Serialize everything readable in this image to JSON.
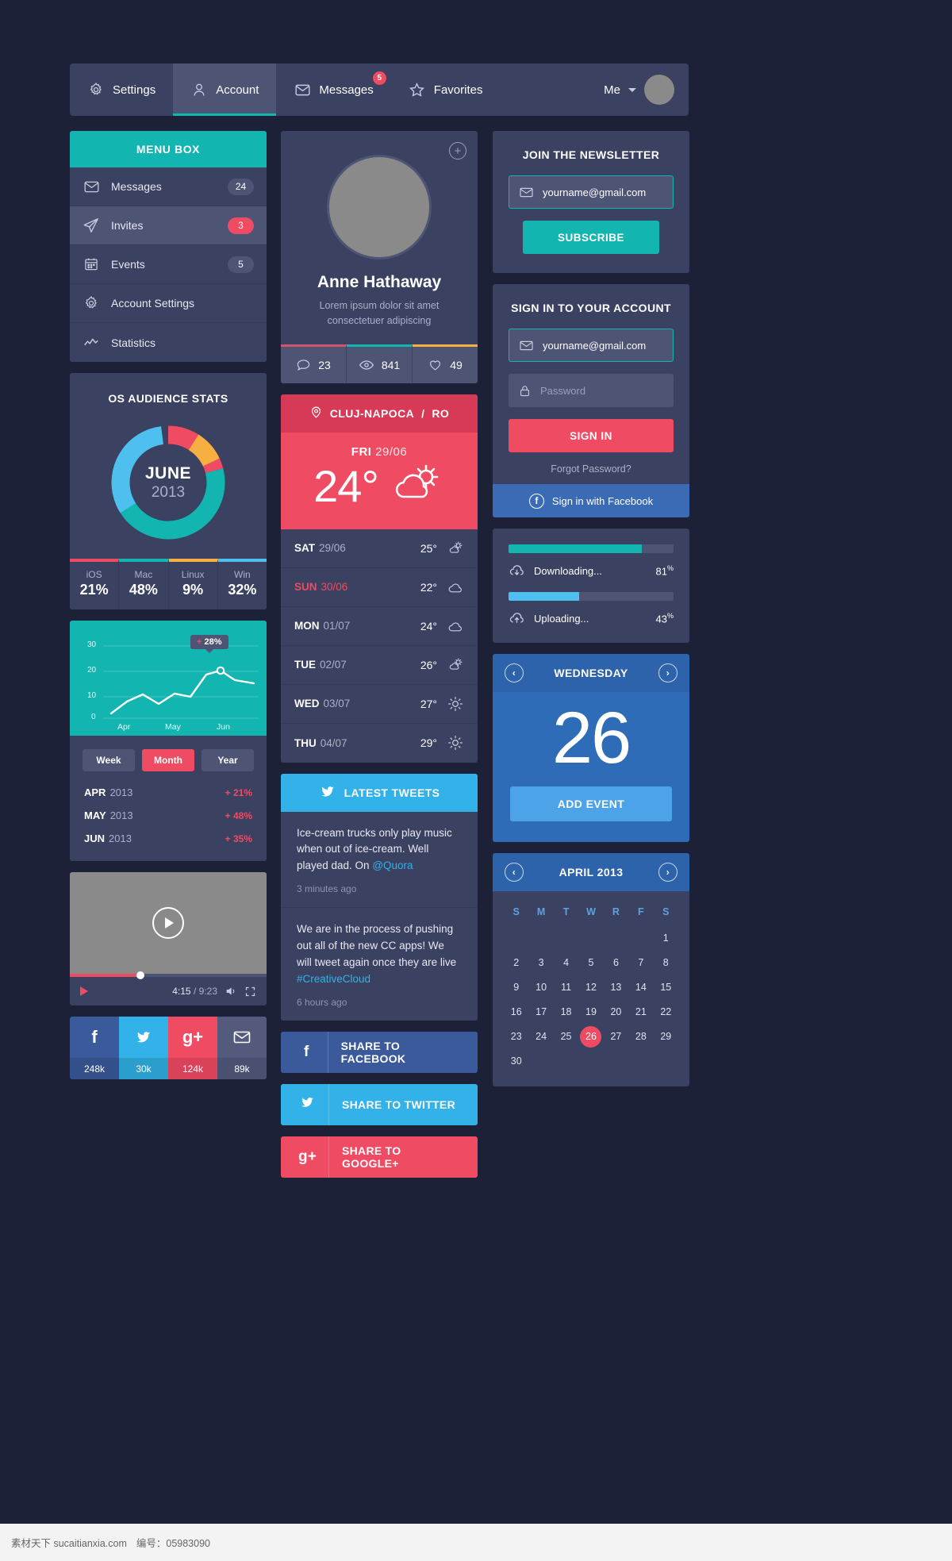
{
  "nav": {
    "items": [
      {
        "label": "Settings",
        "icon": "gear-icon",
        "badge": null,
        "active": false
      },
      {
        "label": "Account",
        "icon": "user-icon",
        "badge": null,
        "active": true
      },
      {
        "label": "Messages",
        "icon": "envelope-icon",
        "badge": "5",
        "active": false
      },
      {
        "label": "Favorites",
        "icon": "star-icon",
        "badge": null,
        "active": false
      }
    ],
    "me_label": "Me"
  },
  "menu_box": {
    "title": "MENU BOX",
    "items": [
      {
        "label": "Messages",
        "icon": "envelope-icon",
        "badge": "24",
        "badge_style": "grey",
        "highlight": false
      },
      {
        "label": "Invites",
        "icon": "paper-plane-icon",
        "badge": "3",
        "badge_style": "pink",
        "highlight": true
      },
      {
        "label": "Events",
        "icon": "calendar-icon",
        "badge": "5",
        "badge_style": "grey",
        "highlight": false
      },
      {
        "label": "Account Settings",
        "icon": "gear-icon",
        "badge": null,
        "badge_style": null,
        "highlight": false
      },
      {
        "label": "Statistics",
        "icon": "chart-line-icon",
        "badge": null,
        "badge_style": null,
        "highlight": false
      }
    ]
  },
  "os_stats": {
    "title": "OS AUDIENCE STATS",
    "center_month": "JUNE",
    "center_year": "2013"
  },
  "chart_data": [
    {
      "type": "pie",
      "title": "OS AUDIENCE STATS",
      "labels": [
        "iOS",
        "Mac",
        "Linux",
        "Win"
      ],
      "values": [
        21,
        48,
        9,
        32
      ],
      "display_values": [
        "21%",
        "48%",
        "9%",
        "32%"
      ],
      "colors": [
        "#ef4b63",
        "#12b5b0",
        "#f5b041",
        "#4dc0f0"
      ],
      "center_label": "JUNE 2013",
      "legend": "bottom"
    },
    {
      "type": "line",
      "title": "",
      "x": [
        "",
        "",
        "",
        "",
        "",
        "",
        "",
        "",
        "",
        ""
      ],
      "values": [
        3,
        7,
        11,
        13,
        8,
        13,
        15,
        13,
        22,
        19,
        16
      ],
      "ylabel": "",
      "xlabel": "",
      "tick_labels_y": [
        "0",
        "10",
        "20",
        "30"
      ],
      "tick_labels_x": [
        "Apr",
        "May",
        "Jun"
      ],
      "ylim": [
        0,
        33
      ],
      "annotation": "+ 28%",
      "grid": true,
      "background": "#12b5b0",
      "line_color": "#ffffff"
    }
  ],
  "trend": {
    "tabs": [
      {
        "label": "Week",
        "active": false
      },
      {
        "label": "Month",
        "active": true
      },
      {
        "label": "Year",
        "active": false
      }
    ],
    "tooltip_sign": "+",
    "tooltip_value": "28%",
    "y_ticks": [
      "30",
      "20",
      "10",
      "0"
    ],
    "x_ticks": [
      "Apr",
      "May",
      "Jun"
    ],
    "rows": [
      {
        "month": "APR",
        "year": "2013",
        "delta": "+ 21%"
      },
      {
        "month": "MAY",
        "year": "2013",
        "delta": "+ 48%"
      },
      {
        "month": "JUN",
        "year": "2013",
        "delta": "+ 35%"
      }
    ]
  },
  "video": {
    "current_time": "4:15",
    "total_time": "9:23",
    "separator": "/"
  },
  "social": [
    {
      "network": "facebook",
      "glyph": "f",
      "count": "248k"
    },
    {
      "network": "twitter",
      "glyph": "t",
      "count": "30k"
    },
    {
      "network": "googleplus",
      "glyph": "g+",
      "count": "124k"
    },
    {
      "network": "mail",
      "glyph": "m",
      "count": "89k"
    }
  ],
  "profile": {
    "name": "Anne Hathaway",
    "description": "Lorem ipsum dolor sit amet consectetuer adipiscing",
    "stats": [
      {
        "icon": "comment-icon",
        "value": "23",
        "color": "#d0566f"
      },
      {
        "icon": "eye-icon",
        "value": "841",
        "color": "#12b5b0"
      },
      {
        "icon": "heart-icon",
        "value": "49",
        "color": "#f5b041"
      }
    ]
  },
  "weather": {
    "city": "CLUJ-NAPOCA",
    "country": "RO",
    "separator": "/",
    "today_day": "FRI",
    "today_date": "29/06",
    "today_temp": "24°",
    "today_icon": "cloud-sun-icon",
    "forecast": [
      {
        "day": "SAT",
        "date": "29/06",
        "temp": "25°",
        "icon": "sun-cloud-small-icon",
        "highlight": false
      },
      {
        "day": "SUN",
        "date": "30/06",
        "temp": "22°",
        "icon": "cloud-icon",
        "highlight": true
      },
      {
        "day": "MON",
        "date": "01/07",
        "temp": "24°",
        "icon": "cloud-icon",
        "highlight": false
      },
      {
        "day": "TUE",
        "date": "02/07",
        "temp": "26°",
        "icon": "sun-cloud-small-icon",
        "highlight": false
      },
      {
        "day": "WED",
        "date": "03/07",
        "temp": "27°",
        "icon": "sun-icon",
        "highlight": false
      },
      {
        "day": "THU",
        "date": "04/07",
        "temp": "29°",
        "icon": "sun-icon",
        "highlight": false
      }
    ]
  },
  "tweets": {
    "title": "LATEST TWEETS",
    "items": [
      {
        "text": "Ice-cream trucks only play music when out of ice-cream. Well played dad. On ",
        "link": "@Quora",
        "ago": "3 minutes ago"
      },
      {
        "text": "We are in the process of pushing out all of the new CC apps! We will tweet again once they are live ",
        "link": "#CreativeCloud",
        "ago": "6 hours ago"
      }
    ]
  },
  "share": [
    {
      "label": "SHARE TO FACEBOOK",
      "glyph": "f",
      "network": "facebook"
    },
    {
      "label": "SHARE TO TWITTER",
      "glyph": "t",
      "network": "twitter"
    },
    {
      "label": "SHARE TO GOOGLE+",
      "glyph": "g+",
      "network": "googleplus"
    }
  ],
  "newsletter": {
    "title": "JOIN THE NEWSLETTER",
    "email_value": "yourname@gmail.com",
    "button": "SUBSCRIBE"
  },
  "signin": {
    "title": "SIGN IN TO YOUR ACCOUNT",
    "email_value": "yourname@gmail.com",
    "password_placeholder": "Password",
    "button": "SIGN IN",
    "forgot": "Forgot Password?",
    "facebook": "Sign in with Facebook"
  },
  "transfers": [
    {
      "label": "Downloading...",
      "percent": "81",
      "suffix": "%",
      "fill": 81,
      "color": "#12b5b0",
      "icon": "cloud-download-icon"
    },
    {
      "label": "Uploading...",
      "percent": "43",
      "suffix": "%",
      "fill": 43,
      "color": "#4dc0f0",
      "icon": "cloud-upload-icon"
    }
  ],
  "day_widget": {
    "title": "WEDNESDAY",
    "number": "26",
    "button": "ADD EVENT",
    "prev_icon": "chevron-left-icon",
    "next_icon": "chevron-right-icon"
  },
  "calendar": {
    "title": "APRIL 2013",
    "dow": [
      "S",
      "M",
      "T",
      "W",
      "R",
      "F",
      "S"
    ],
    "leading_blanks": 6,
    "days": [
      1,
      2,
      3,
      4,
      5,
      6,
      7,
      8,
      9,
      10,
      11,
      12,
      13,
      14,
      15,
      16,
      17,
      18,
      19,
      20,
      21,
      22,
      23,
      24,
      25,
      26,
      27,
      28,
      29,
      30
    ],
    "selected": 26,
    "prev_icon": "chevron-left-icon",
    "next_icon": "chevron-right-icon"
  },
  "watermark": {
    "site": "素材天下 sucaitianxia.com",
    "code": "编号：05983090"
  }
}
